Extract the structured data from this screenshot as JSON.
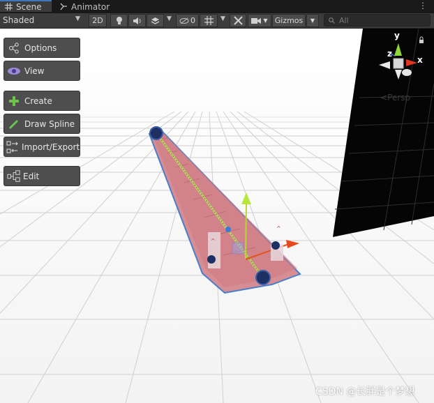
{
  "tabs": [
    {
      "label": "Scene",
      "icon": "grid-icon"
    },
    {
      "label": "Animator",
      "icon": "animator-icon"
    }
  ],
  "toolbar": {
    "shading_mode": "Shaded",
    "mode_2d": "2D",
    "hidden_count": "0",
    "gizmos_label": "Gizmos",
    "search_placeholder": "All"
  },
  "sidebar": {
    "items": [
      {
        "label": "Options",
        "icon": "options-icon"
      },
      {
        "label": "View",
        "icon": "eye-icon"
      },
      {
        "label": "Create",
        "icon": "plus-icon"
      },
      {
        "label": "Draw Spline",
        "icon": "pencil-icon"
      },
      {
        "label": "Import/Export",
        "icon": "import-export-icon"
      },
      {
        "label": "Edit",
        "icon": "edit-nodes-icon"
      }
    ]
  },
  "orientation_gizmo": {
    "y": "y",
    "x": "x",
    "z": "z",
    "projection": "Persp"
  },
  "watermark": "CSDN @长胖是个梦想"
}
